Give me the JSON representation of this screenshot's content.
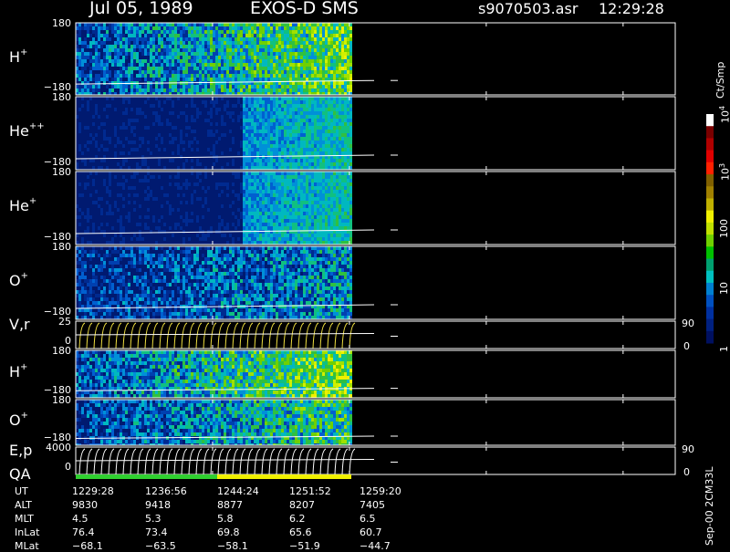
{
  "header": {
    "date": "Jul 05, 1989",
    "instrument": "EXOS-D SMS",
    "file": "s9070503.asr",
    "time": "12:29:28"
  },
  "panels": [
    {
      "id": "h1",
      "label": "H",
      "sup": "+",
      "ymax": "180",
      "ymin": "−180",
      "level": 0.55
    },
    {
      "id": "hepp",
      "label": "He",
      "sup": "++",
      "ymax": "180",
      "ymin": "−180",
      "level": 0.15
    },
    {
      "id": "hep",
      "label": "He",
      "sup": "+",
      "ymax": "180",
      "ymin": "−180",
      "level": 0.2
    },
    {
      "id": "o1",
      "label": "O",
      "sup": "+",
      "ymax": "180",
      "ymin": "−180",
      "level": 0.3
    },
    {
      "id": "vr",
      "label": "V,r",
      "sup": "",
      "ymax": "25",
      "ymin": "0",
      "rtop": "90",
      "rbot": "0"
    },
    {
      "id": "h2",
      "label": "H",
      "sup": "+",
      "ymax": "180",
      "ymin": "−180",
      "level": 0.6
    },
    {
      "id": "o2",
      "label": "O",
      "sup": "+",
      "ymax": "180",
      "ymin": "−180",
      "level": 0.45
    },
    {
      "id": "ep",
      "label": "E,p",
      "sup": "",
      "ymax": "4000",
      "ymin": "0",
      "rtop": "90",
      "rbot": "0"
    }
  ],
  "qa_label": "QA",
  "colorbar": {
    "unit": "Ct/Smp",
    "ticks": [
      {
        "base": "10",
        "exp": "4",
        "frac": 0.0
      },
      {
        "base": "10",
        "exp": "3",
        "frac": 0.25
      },
      {
        "base": "100",
        "exp": "",
        "frac": 0.5
      },
      {
        "base": "10",
        "exp": "",
        "frac": 0.75
      },
      {
        "base": "1",
        "exp": "",
        "frac": 1.0
      }
    ],
    "colors": [
      "#ffffff",
      "#7a0000",
      "#b00000",
      "#e00000",
      "#ff2000",
      "#806000",
      "#a08000",
      "#c0b000",
      "#f0f000",
      "#c0e000",
      "#70d000",
      "#00c000",
      "#00a070",
      "#00c0c0",
      "#0080d0",
      "#0050c0",
      "#0030a0",
      "#002080",
      "#001060"
    ]
  },
  "footer": {
    "rows": [
      {
        "label": "UT",
        "values": [
          "1229:28",
          "1236:56",
          "1244:24",
          "1251:52",
          "1259:20"
        ]
      },
      {
        "label": "ALT",
        "values": [
          "9830",
          "9418",
          "8877",
          "8207",
          "7405"
        ]
      },
      {
        "label": "MLT",
        "values": [
          "4.5",
          "5.3",
          "5.8",
          "6.2",
          "6.5"
        ]
      },
      {
        "label": "InLat",
        "values": [
          "76.4",
          "73.4",
          "69.8",
          "65.6",
          "60.7"
        ]
      },
      {
        "label": "MLat",
        "values": [
          "−68.1",
          "−63.5",
          "−58.1",
          "−51.9",
          "−44.7"
        ]
      }
    ],
    "version": "Sep-00 2CM33L"
  },
  "chart_data": {
    "type": "heatmap",
    "title": "Jul 05, 1989   EXOS-D SMS",
    "x_ticks": [
      "1229:28",
      "1236:56",
      "1244:24",
      "1251:52",
      "1259:20"
    ],
    "colorbar_unit": "Ct/Smp",
    "colorbar_range": [
      1,
      10000
    ],
    "colorbar_scale": "log",
    "panels": [
      "H+",
      "He++",
      "He+",
      "O+",
      "V,r",
      "H+",
      "O+",
      "E,p"
    ]
  }
}
